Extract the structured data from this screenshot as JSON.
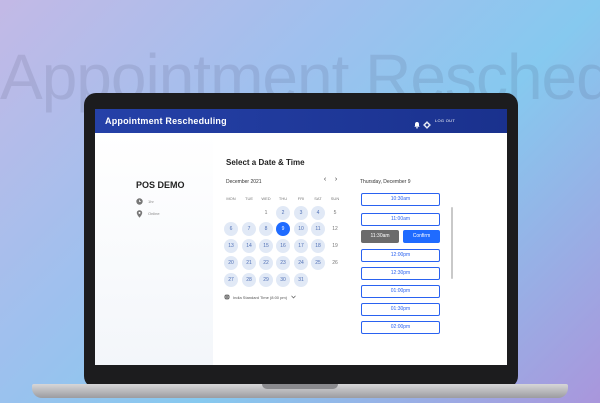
{
  "background": {
    "watermark": "Appointment Resched"
  },
  "header": {
    "title": "Appointment Rescheduling",
    "logout_label": "LOG OUT"
  },
  "event": {
    "title": "POS DEMO",
    "duration": "1hr",
    "location": "Online"
  },
  "calendar": {
    "section_title": "Select a Date & Time",
    "month": "December 2021",
    "prev_icon": "‹",
    "next_icon": "›",
    "weekdays": [
      "MON",
      "TUE",
      "WED",
      "THU",
      "FRI",
      "SAT",
      "SUN"
    ],
    "weeks": [
      [
        {
          "d": "",
          "s": "empty"
        },
        {
          "d": "",
          "s": "empty"
        },
        {
          "d": "1",
          "s": "plain"
        },
        {
          "d": "2",
          "s": "avail"
        },
        {
          "d": "3",
          "s": "avail"
        },
        {
          "d": "4",
          "s": "avail"
        },
        {
          "d": "5",
          "s": "plain"
        }
      ],
      [
        {
          "d": "6",
          "s": "avail"
        },
        {
          "d": "7",
          "s": "avail"
        },
        {
          "d": "8",
          "s": "avail"
        },
        {
          "d": "9",
          "s": "selected"
        },
        {
          "d": "10",
          "s": "avail"
        },
        {
          "d": "11",
          "s": "avail"
        },
        {
          "d": "12",
          "s": "plain"
        }
      ],
      [
        {
          "d": "13",
          "s": "avail"
        },
        {
          "d": "14",
          "s": "avail"
        },
        {
          "d": "15",
          "s": "avail"
        },
        {
          "d": "16",
          "s": "avail"
        },
        {
          "d": "17",
          "s": "avail"
        },
        {
          "d": "18",
          "s": "avail"
        },
        {
          "d": "19",
          "s": "plain"
        }
      ],
      [
        {
          "d": "20",
          "s": "avail"
        },
        {
          "d": "21",
          "s": "avail"
        },
        {
          "d": "22",
          "s": "avail"
        },
        {
          "d": "23",
          "s": "avail"
        },
        {
          "d": "24",
          "s": "avail"
        },
        {
          "d": "25",
          "s": "avail"
        },
        {
          "d": "26",
          "s": "plain"
        }
      ],
      [
        {
          "d": "27",
          "s": "avail"
        },
        {
          "d": "28",
          "s": "avail"
        },
        {
          "d": "29",
          "s": "avail"
        },
        {
          "d": "30",
          "s": "avail"
        },
        {
          "d": "31",
          "s": "avail"
        },
        {
          "d": "",
          "s": "empty"
        },
        {
          "d": "",
          "s": "empty"
        }
      ]
    ],
    "timezone": "India Standard Time (8:00 pm)",
    "timezone_icon": "globe-icon"
  },
  "times": {
    "date_heading": "Thursday, December 9",
    "slots_top": [
      "10:30am",
      "11:00am"
    ],
    "selected_slot": "11:30am",
    "confirm_label": "Confirm",
    "slots_bottom": [
      "12:00pm",
      "12:30pm",
      "01:00pm",
      "01:30pm",
      "02:00pm"
    ]
  },
  "colors": {
    "header": "#1f3a9e",
    "accent": "#1f6bff",
    "available_day": "#e1e9f6",
    "selected_slot": "#6b6b6b"
  }
}
